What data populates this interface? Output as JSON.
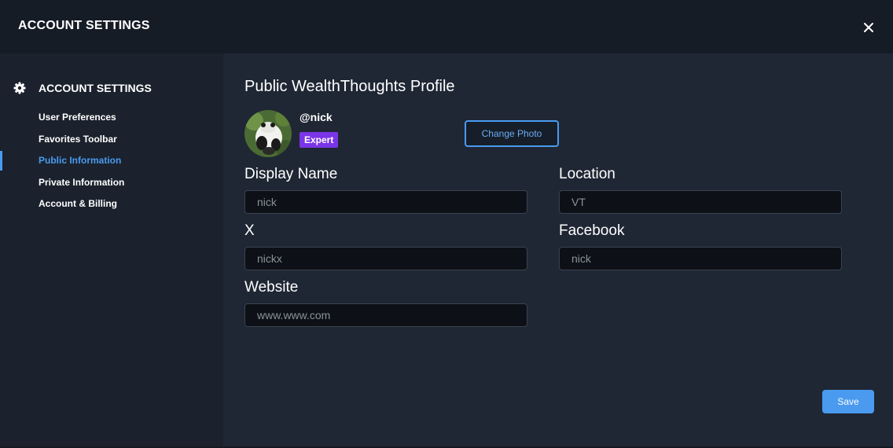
{
  "header": {
    "title": "ACCOUNT SETTINGS",
    "close_icon": "close-icon"
  },
  "sidebar": {
    "heading": "ACCOUNT SETTINGS",
    "heading_icon": "gear-icon",
    "items": [
      {
        "label": "User Preferences",
        "active": false
      },
      {
        "label": "Favorites Toolbar",
        "active": false
      },
      {
        "label": "Public Information",
        "active": true
      },
      {
        "label": "Private Information",
        "active": false
      },
      {
        "label": "Account & Billing",
        "active": false
      }
    ]
  },
  "profile": {
    "title": "Public WealthThoughts Profile",
    "username": "@nick",
    "badge": "Expert",
    "change_photo_label": "Change Photo"
  },
  "fields": {
    "display_name": {
      "label": "Display Name",
      "value": "nick"
    },
    "location": {
      "label": "Location",
      "value": "VT"
    },
    "x": {
      "label": "X",
      "value": "nickx"
    },
    "facebook": {
      "label": "Facebook",
      "value": "nick"
    },
    "website": {
      "label": "Website",
      "value": "www.www.com"
    }
  },
  "actions": {
    "save_label": "Save"
  },
  "colors": {
    "accent": "#4a9af0",
    "badge": "#7b35e8",
    "background": "#1f2734",
    "sidebar": "#1b222d",
    "header": "#161c26"
  }
}
